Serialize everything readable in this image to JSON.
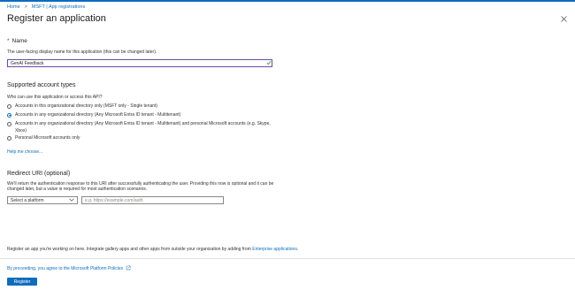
{
  "breadcrumb": {
    "items": [
      "Home",
      "MSFT | App registrations"
    ],
    "separator": ">"
  },
  "page": {
    "title": "Register an application",
    "more": "..."
  },
  "name_section": {
    "required_mark": "*",
    "label": "Name",
    "hint": "The user-facing display name for this application (this can be changed later).",
    "value": "GenAI Feedback"
  },
  "account_types": {
    "heading": "Supported account types",
    "question": "Who can use this application or access this API?",
    "options": [
      {
        "label": "Accounts in this organizational directory only (MSFT only - Single tenant)",
        "selected": false
      },
      {
        "label": "Accounts in any organizational directory (Any Microsoft Entra ID tenant - Multitenant)",
        "selected": true
      },
      {
        "label": "Accounts in any organizational directory (Any Microsoft Entra ID tenant - Multitenant) and personal Microsoft accounts (e.g. Skype,",
        "label_line2": "Xbox)",
        "selected": false
      },
      {
        "label": "Personal Microsoft accounts only",
        "selected": false
      }
    ],
    "help_link": "Help me choose..."
  },
  "redirect": {
    "heading": "Redirect URI (optional)",
    "description_line1": "We'll return the authentication response to this URI after successfully authenticating the user. Providing this now is optional and it can be",
    "description_line2": "changed later, but a value is required for most authentication scenarios.",
    "platform_select": "Select a platform",
    "uri_placeholder": "e.g. https://example.com/auth"
  },
  "gallery_note": {
    "text": "Register an app you're working on here. Integrate gallery apps and other apps from outside your organization by adding from ",
    "link": "Enterprise applications",
    "suffix": "."
  },
  "footer": {
    "policy_text": "By proceeding, you agree to the Microsoft Platform Policies",
    "register_label": "Register"
  },
  "colors": {
    "accent": "#0f6cbd",
    "input_focus": "#6a4ba8",
    "valid": "#107c10",
    "required": "#a4262c"
  },
  "icons": {
    "close": "close-icon",
    "valid": "checkmark-icon",
    "dropdown": "chevron-down-icon",
    "external": "external-link-icon"
  }
}
